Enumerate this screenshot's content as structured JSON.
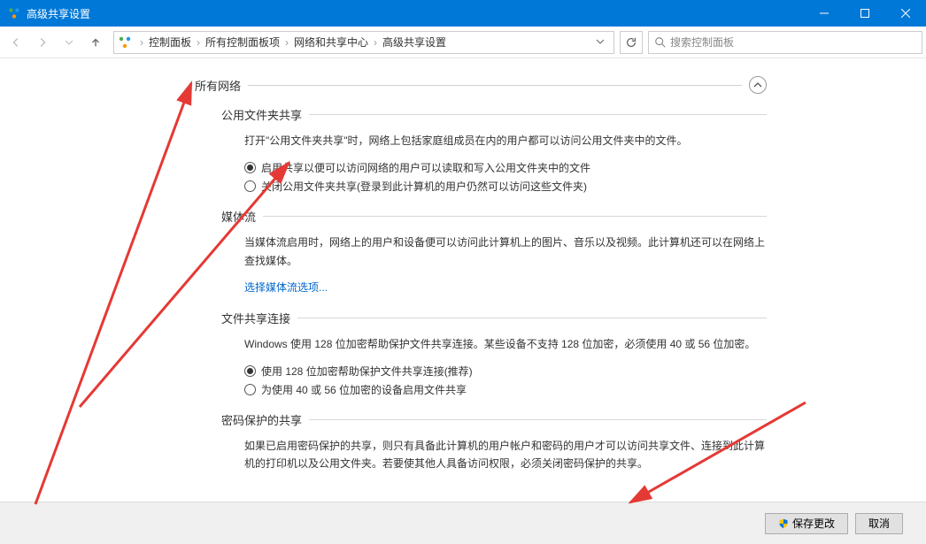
{
  "window": {
    "title": "高级共享设置"
  },
  "breadcrumb": {
    "items": [
      "控制面板",
      "所有控制面板项",
      "网络和共享中心",
      "高级共享设置"
    ]
  },
  "search": {
    "placeholder": "搜索控制面板"
  },
  "profile": {
    "title": "所有网络"
  },
  "sections": {
    "publicFolder": {
      "title": "公用文件夹共享",
      "desc": "打开\"公用文件夹共享\"时，网络上包括家庭组成员在内的用户都可以访问公用文件夹中的文件。",
      "opt1": "启用共享以便可以访问网络的用户可以读取和写入公用文件夹中的文件",
      "opt2": "关闭公用文件夹共享(登录到此计算机的用户仍然可以访问这些文件夹)"
    },
    "mediaStream": {
      "title": "媒体流",
      "desc": "当媒体流启用时，网络上的用户和设备便可以访问此计算机上的图片、音乐以及视频。此计算机还可以在网络上查找媒体。",
      "link": "选择媒体流选项..."
    },
    "fileConn": {
      "title": "文件共享连接",
      "desc": "Windows 使用 128 位加密帮助保护文件共享连接。某些设备不支持 128 位加密，必须使用 40 或 56 位加密。",
      "opt1": "使用 128 位加密帮助保护文件共享连接(推荐)",
      "opt2": "为使用 40 或 56 位加密的设备启用文件共享"
    },
    "password": {
      "title": "密码保护的共享",
      "desc": "如果已启用密码保护的共享，则只有具备此计算机的用户帐户和密码的用户才可以访问共享文件、连接到此计算机的打印机以及公用文件夹。若要使其他人具备访问权限，必须关闭密码保护的共享。"
    }
  },
  "footer": {
    "save": "保存更改",
    "cancel": "取消"
  }
}
